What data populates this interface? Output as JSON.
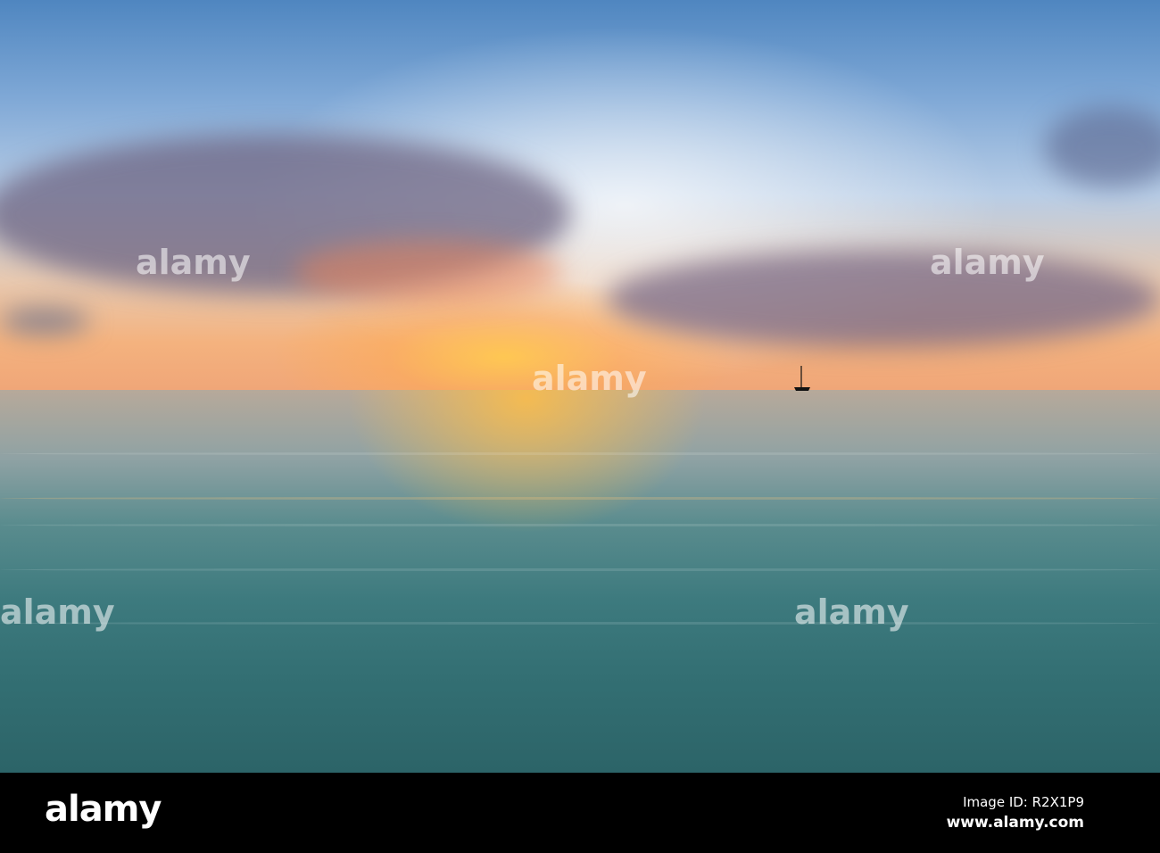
{
  "watermark": "alamy",
  "footer": {
    "logo": "alamy",
    "image_id": "Image ID: R2X1P9",
    "website": "www.alamy.com"
  }
}
